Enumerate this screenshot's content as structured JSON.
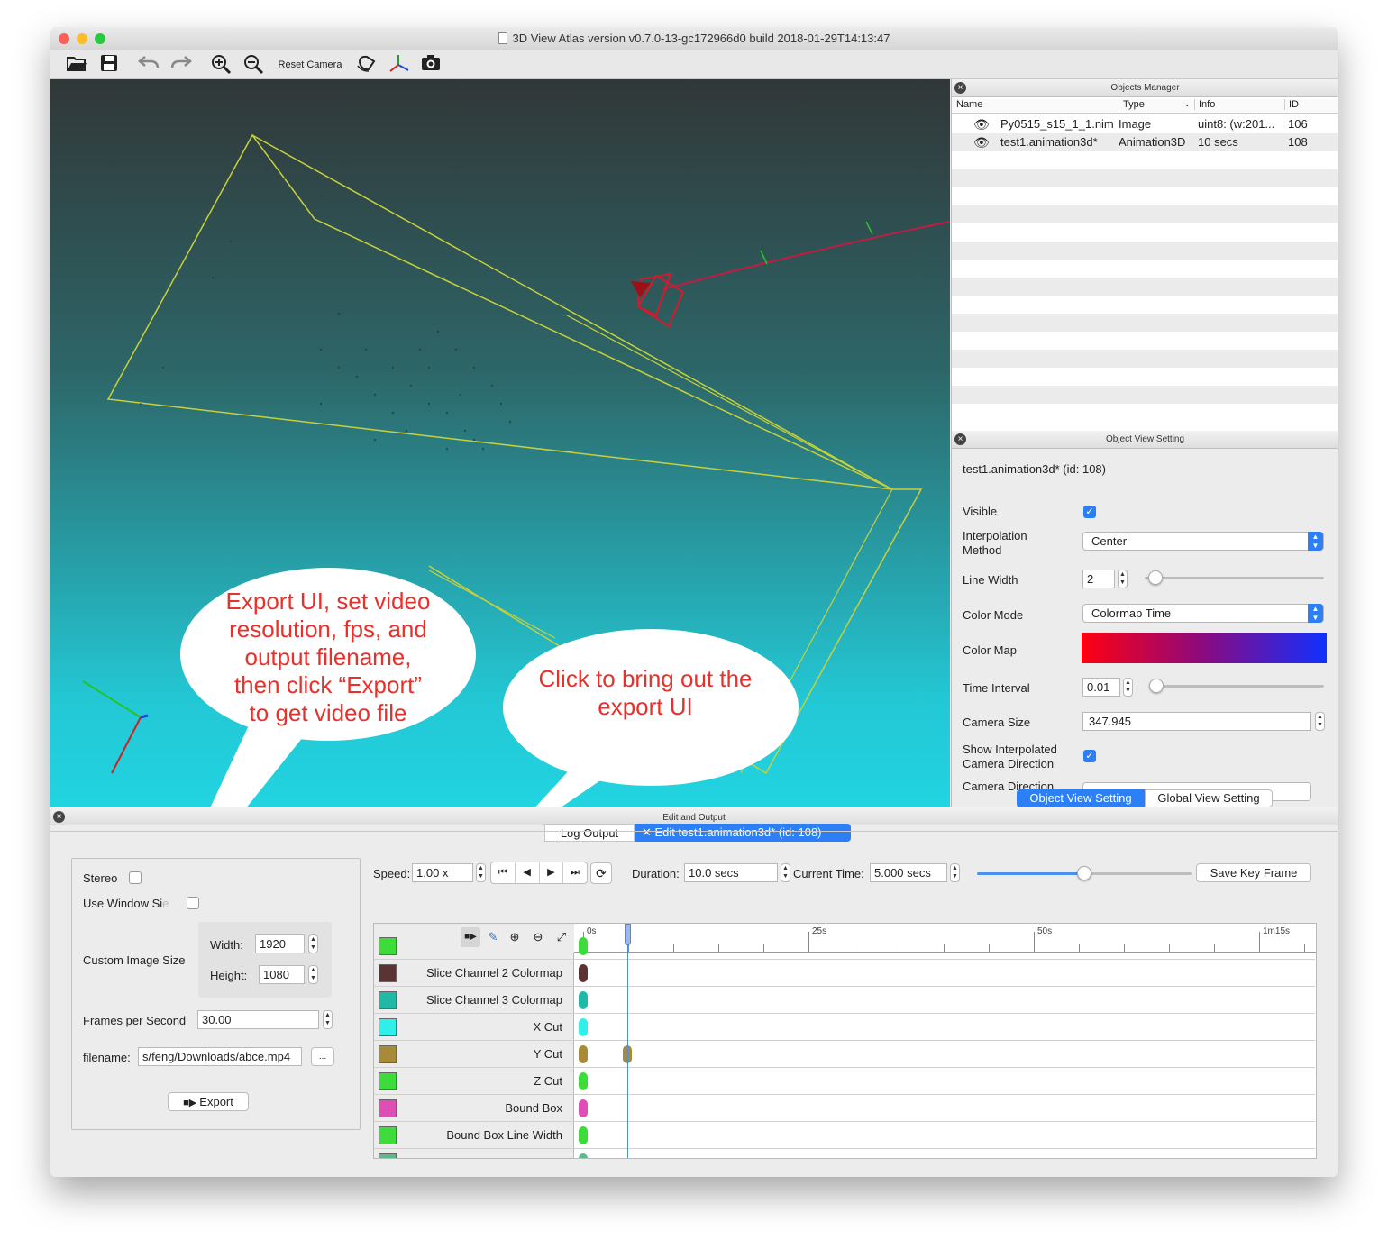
{
  "window": {
    "title": "3D View  Atlas version v0.7.0-13-gc172966d0 build 2018-01-29T14:13:47"
  },
  "toolbar": {
    "reset_camera": "Reset Camera",
    "icons": [
      "open-folder-icon",
      "save-icon",
      "undo-icon",
      "redo-icon",
      "zoom-in-icon",
      "zoom-out-icon",
      "rotate-icon",
      "axes-icon",
      "camera-snapshot-icon"
    ]
  },
  "objects_manager": {
    "title": "Objects Manager",
    "columns": [
      "Name",
      "Type",
      "Info",
      "ID"
    ],
    "rows": [
      {
        "name": "Py0515_s15_1_1.nim",
        "type": "Image",
        "info": "uint8: (w:201...",
        "id": "106"
      },
      {
        "name": "test1.animation3d*",
        "type": "Animation3D",
        "info": "10 secs",
        "id": "108"
      }
    ]
  },
  "object_view_setting": {
    "title": "Object View Setting",
    "object_title": "test1.animation3d* (id: 108)",
    "visible_label": "Visible",
    "visible_checked": true,
    "interp_label_1": "Interpolation",
    "interp_label_2": "Method",
    "interp_value": "Center",
    "line_width_label": "Line Width",
    "line_width_value": "2",
    "line_width_level": 0.02,
    "color_mode_label": "Color Mode",
    "color_mode_value": "Colormap Time",
    "color_map_label": "Color Map",
    "time_interval_label": "Time Interval",
    "time_interval_value": "0.01",
    "camera_size_label": "Camera Size",
    "camera_size_value": "347.945",
    "show_interp_label_1": "Show Interpolated",
    "show_interp_label_2": "Camera Direction",
    "show_interp_checked": true,
    "camera_direction_label": "Camera Direction",
    "tabs": [
      "Object View Setting",
      "Global View Setting"
    ],
    "colormap_colors": [
      "#ff0010",
      "#8a0a80",
      "#1030ff"
    ]
  },
  "edit_output": {
    "title": "Edit and Output",
    "tabs": [
      "Log Output",
      "Edit test1.animation3d* (id: 108)"
    ],
    "export": {
      "stereo_label": "Stereo",
      "use_window_size_label": "Use Window Si",
      "use_window_size_suffix": "e",
      "custom_size_label": "Custom Image Size",
      "width_label": "Width:",
      "width_value": "1920",
      "height_label": "Height:",
      "height_value": "1080",
      "fps_label": "Frames per Second",
      "fps_value": "30.00",
      "filename_label": "filename:",
      "filename_value": "s/feng/Downloads/abce.mp4",
      "browse_label": "...",
      "export_button": "Export"
    },
    "timeline": {
      "speed_label": "Speed:",
      "speed_value": "1.00 x",
      "duration_label": "Duration:",
      "duration_value": "10.0 secs",
      "current_time_label": "Current Time:",
      "current_time_value": "5.000 secs",
      "time_slider_level": 0.5,
      "save_key_frame": "Save Key Frame",
      "ticks": [
        "0s",
        "25s",
        "50s",
        "1m15s"
      ],
      "tracks": [
        {
          "name": "Slice Channel 2 Colormap",
          "color": "#5a3434"
        },
        {
          "name": "Slice Channel 3 Colormap",
          "color": "#22b8a6"
        },
        {
          "name": "X Cut",
          "color": "#2ef0e8"
        },
        {
          "name": "Y Cut",
          "color": "#a88b38"
        },
        {
          "name": "Z Cut",
          "color": "#3ddc3b"
        },
        {
          "name": "Bound Box",
          "color": "#de4fb6"
        },
        {
          "name": "Bound Box Line Width",
          "color": "#3ddc3b"
        }
      ]
    }
  },
  "annotations": {
    "export_bubble": [
      "Export UI, set video",
      "resolution, fps, and",
      "output filename,",
      "then click “Export”",
      "to get video file"
    ],
    "bring_bubble": [
      "Click to bring out the",
      "export UI"
    ]
  }
}
